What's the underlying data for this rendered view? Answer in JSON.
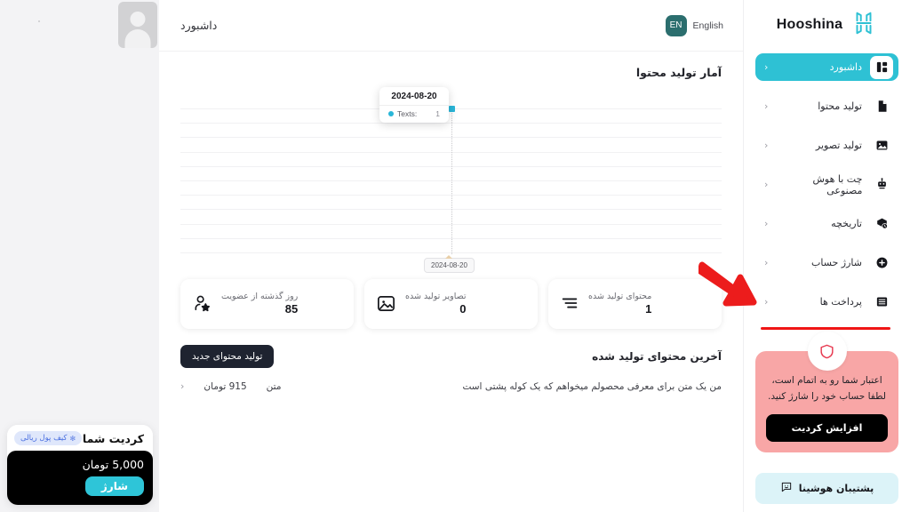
{
  "brand": {
    "name": "Hooshina",
    "logo_icon": "hooshina-h-logo",
    "color": "#2ec1d4"
  },
  "header": {
    "page_title": "داشبورد",
    "language": {
      "label": "English",
      "badge": "EN",
      "badge_color": "#2b6e6e"
    }
  },
  "profile": {
    "avatar_icon": "user-avatar-placeholder"
  },
  "wallet": {
    "title": "کردیت شما",
    "badge": "کیف پول ریالی",
    "badge_icon": "sparkle-icon",
    "amount": "5,000 تومان",
    "charge_label": "شارژ"
  },
  "content_stats": {
    "section_title": "آمار تولید محتوا"
  },
  "chart_data": {
    "type": "line",
    "title": "آمار تولید محتوا",
    "xlabel": "",
    "ylabel": "",
    "x": [
      "2024-08-20"
    ],
    "categories": [
      "2024-08-20"
    ],
    "series": [
      {
        "name": "Texts",
        "values": [
          1
        ],
        "color": "#29b6d8"
      }
    ],
    "ylim": [
      0,
      1
    ],
    "grid": true,
    "gridlines": 11,
    "legend_position": "none",
    "tooltip": {
      "date": "2024-08-20",
      "series_name": ":Texts",
      "value": "1",
      "swatch_color": "#29b6d8"
    },
    "axis_label": "2024-08-20"
  },
  "stats": [
    {
      "label": "محتوای تولید شده",
      "value": "1",
      "icon": "lines-list-icon"
    },
    {
      "label": "تصاویر تولید شده",
      "value": "0",
      "icon": "image-icon"
    },
    {
      "label": "روز گذشته از عضویت",
      "value": "85",
      "icon": "user-star-icon"
    }
  ],
  "recent": {
    "title": "آخرین محتوای تولید شده",
    "new_button": "تولید محتوای جدید",
    "rows": [
      {
        "description": "من یک متن برای معرفی محصولم میخواهم که یک کوله پشتی است",
        "type": "متن",
        "price": "915 تومان",
        "chevron": "‹"
      }
    ]
  },
  "sidebar": {
    "items": [
      {
        "label": "داشبورد",
        "icon": "dashboard-grid-icon",
        "active": true,
        "chevron": "‹"
      },
      {
        "label": "تولید محتوا",
        "icon": "document-icon",
        "active": false,
        "chevron": "‹"
      },
      {
        "label": "تولید تصویر",
        "icon": "image-icon",
        "active": false,
        "chevron": "‹"
      },
      {
        "label": "چت با هوش مصنوعی",
        "icon": "robot-icon",
        "active": false,
        "chevron": "‹"
      },
      {
        "label": "تاریخچه",
        "icon": "history-clock-icon",
        "active": false,
        "chevron": "‹"
      },
      {
        "label": "شارژ حساب",
        "icon": "plus-circle-icon",
        "active": false,
        "chevron": "‹"
      },
      {
        "label": "پرداخت ها",
        "icon": "payments-list-icon",
        "active": false,
        "chevron": "‹"
      }
    ],
    "alert": {
      "icon": "shield-icon",
      "text": "اعتبار شما رو به اتمام است، لطفا حساب خود را شارژ کنید.",
      "button": "افزایش کردیت",
      "bg_color": "#f8a6a6"
    },
    "support_button": {
      "label": "پشتیبان هوشینا",
      "icon": "chat-smile-icon"
    }
  },
  "annotation": {
    "arrow_icon": "red-arrow-pointing-down-right",
    "color": "#f01515"
  }
}
